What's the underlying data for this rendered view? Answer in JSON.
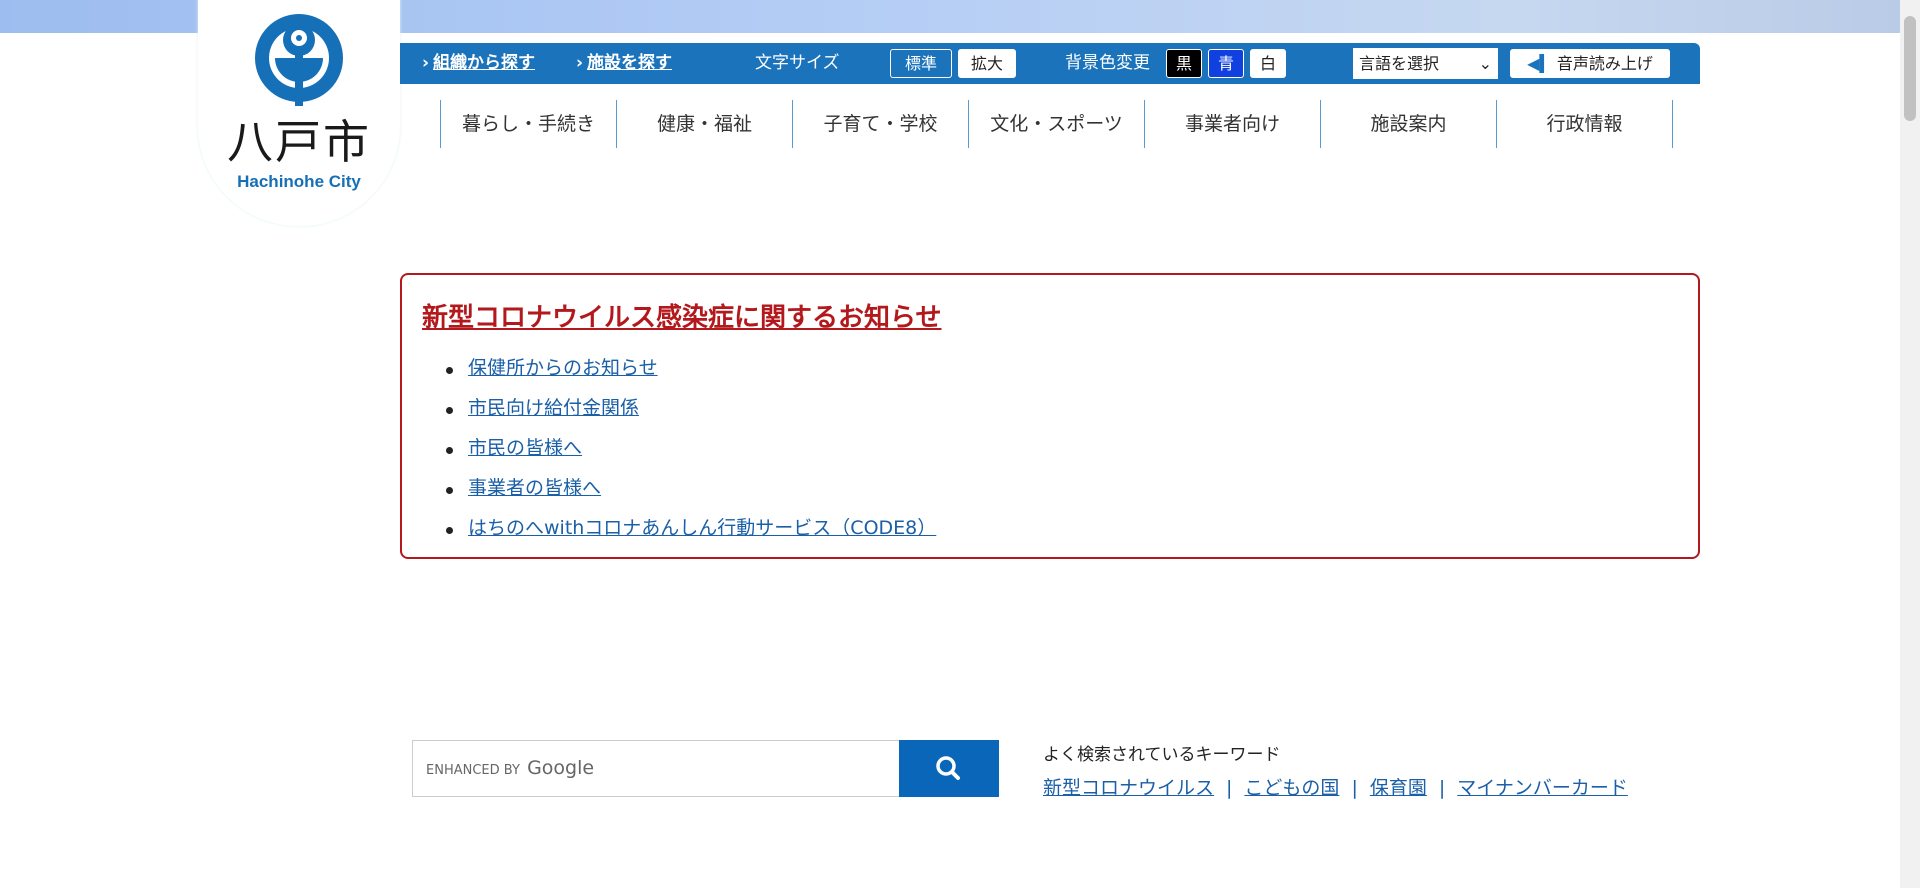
{
  "logo": {
    "name_jp": "八戸市",
    "name_en": "Hachinohe City"
  },
  "utility": {
    "links": [
      "組織から探す",
      "施設を探す"
    ],
    "font_size_label": "文字サイズ",
    "font_sizes": [
      "標準",
      "拡大"
    ],
    "bg_label": "背景色変更",
    "bg_options": [
      "黒",
      "青",
      "白"
    ],
    "language_select": "言語を選択",
    "read_aloud": "音声読み上げ"
  },
  "nav": [
    "暮らし・手続き",
    "健康・福祉",
    "子育て・学校",
    "文化・スポーツ",
    "事業者向け",
    "施設案内",
    "行政情報"
  ],
  "notice": {
    "title": "新型コロナウイルス感染症に関するお知らせ",
    "items": [
      "保健所からのお知らせ",
      "市民向け給付金関係",
      "市民の皆様へ",
      "事業者の皆様へ",
      "はちのへwithコロナあんしん行動サービス（CODE8）"
    ]
  },
  "search": {
    "placeholder_prefix": "ENHANCED BY",
    "placeholder_brand": "Google",
    "keywords_label": "よく検索されているキーワード",
    "keywords": [
      "新型コロナウイルス",
      "こどもの国",
      "保育園",
      "マイナンバーカード"
    ]
  },
  "colors": {
    "brand": "#1a73bb",
    "alert": "#b3191c"
  }
}
